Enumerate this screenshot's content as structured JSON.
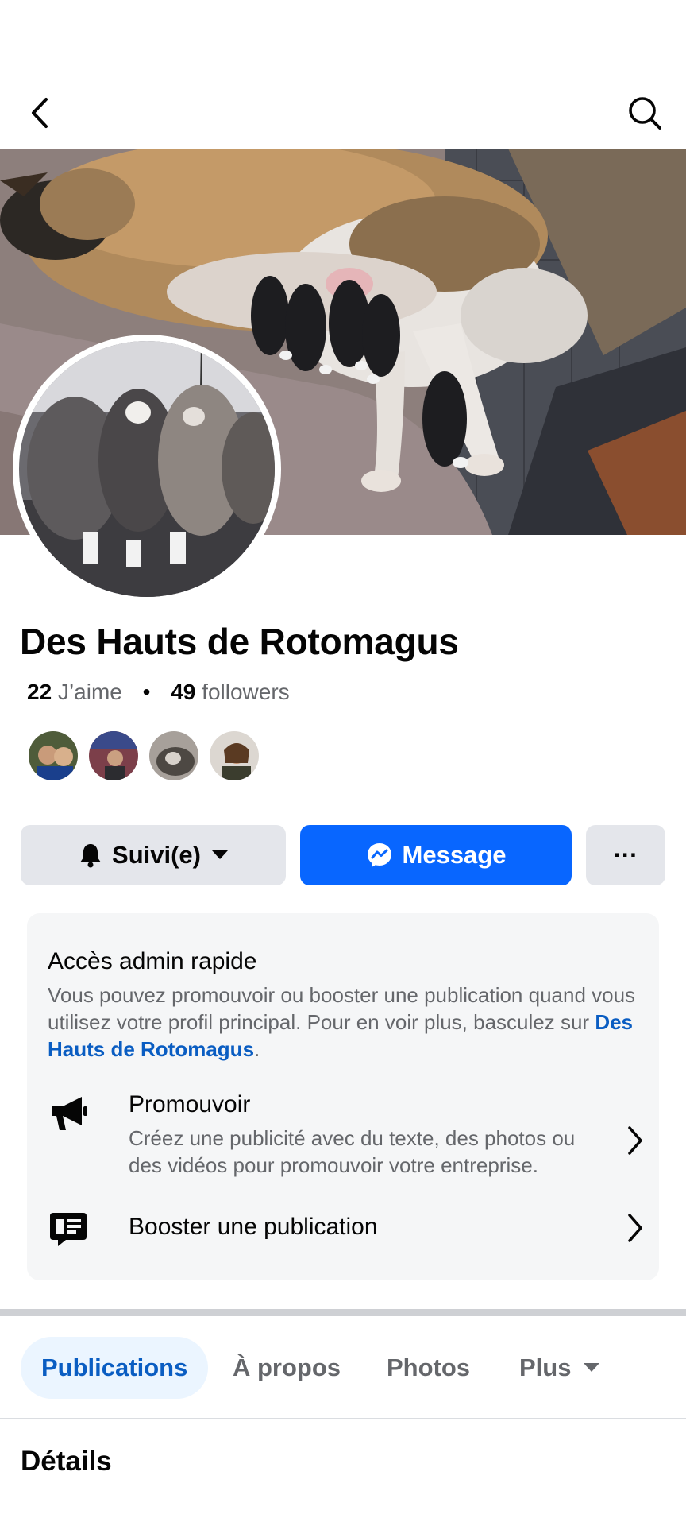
{
  "header": {
    "back_icon": "chevron-left-icon",
    "search_icon": "search-icon"
  },
  "page": {
    "name": "Des Hauts de Rotomagus",
    "likes_count": "22",
    "likes_label": "J’aime",
    "separator": "•",
    "followers_count": "49",
    "followers_label": "followers"
  },
  "actions": {
    "follow_label": "Suivi(e)",
    "message_label": "Message",
    "more_label": "···"
  },
  "admin": {
    "title": "Accès admin rapide",
    "description": "Vous pouvez promouvoir ou booster une publication quand vous utilisez votre profil principal. Pour en voir plus, basculez sur ",
    "description_link": "Des Hauts de Rotomagus",
    "description_end": ".",
    "promote_title": "Promouvoir",
    "promote_subtitle": "Créez une publicité avec du texte, des photos ou des vidéos pour promouvoir votre entreprise.",
    "boost_title": "Booster une publication"
  },
  "tabs": [
    {
      "label": "Publications"
    },
    {
      "label": "À propos"
    },
    {
      "label": "Photos"
    },
    {
      "label": "Plus"
    }
  ],
  "section": {
    "title": "Détails"
  },
  "colors": {
    "accent": "#0866ff",
    "link": "#0a5dc2",
    "secondary_button": "#e4e6eb"
  }
}
